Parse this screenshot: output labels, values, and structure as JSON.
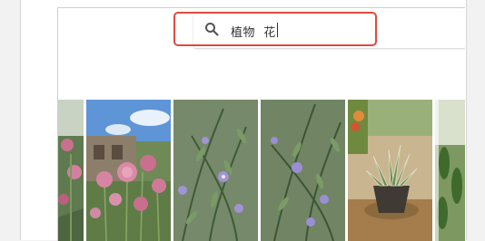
{
  "search": {
    "query": "植物  花",
    "icon": "search-icon"
  },
  "colors": {
    "highlight_border": "#e04a3f",
    "page_background": "#f2f2f2"
  },
  "results": [
    {
      "subject": "pink-flowers-partial"
    },
    {
      "subject": "pink-clover-flowers-blue-sky"
    },
    {
      "subject": "rosemary-purple-flowers"
    },
    {
      "subject": "rosemary-purple-flowers-2"
    },
    {
      "subject": "succulent-in-pot"
    },
    {
      "subject": "green-plant-partial"
    }
  ]
}
